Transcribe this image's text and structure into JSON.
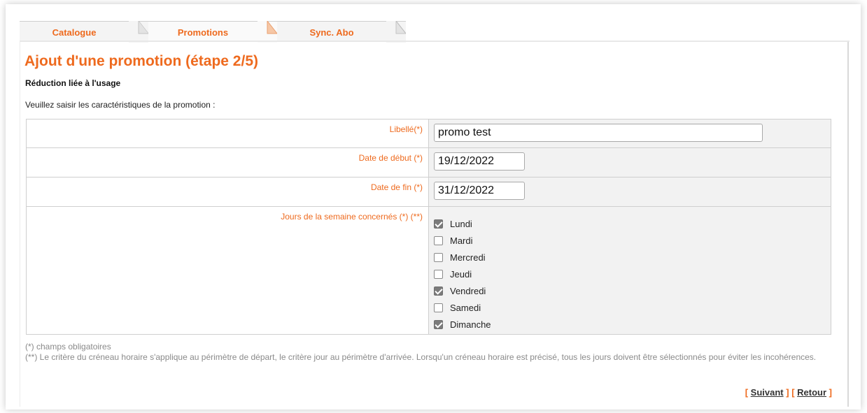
{
  "tabs": [
    {
      "label": "Catalogue"
    },
    {
      "label": "Promotions"
    },
    {
      "label": "Sync. Abo"
    }
  ],
  "page": {
    "title": "Ajout d'une promotion (étape 2/5)",
    "subtitle": "Réduction liée à l'usage",
    "intro": "Veuillez saisir les caractéristiques de la promotion :"
  },
  "form": {
    "libelle": {
      "label": "Libellé(*)",
      "value": "promo test"
    },
    "date_debut": {
      "label": "Date de début (*)",
      "value": "19/12/2022"
    },
    "date_fin": {
      "label": "Date de fin (*)",
      "value": "31/12/2022"
    },
    "jours": {
      "label": "Jours de la semaine concernés (*) (**)",
      "days": [
        {
          "label": "Lundi",
          "checked": true
        },
        {
          "label": "Mardi",
          "checked": false
        },
        {
          "label": "Mercredi",
          "checked": false
        },
        {
          "label": "Jeudi",
          "checked": false
        },
        {
          "label": "Vendredi",
          "checked": true
        },
        {
          "label": "Samedi",
          "checked": false
        },
        {
          "label": "Dimanche",
          "checked": true
        }
      ]
    }
  },
  "notes": {
    "required": "(*) champs obligatoires",
    "criteria": "(**) Le critère du créneau horaire s'applique au périmètre de départ, le critère jour au périmètre d'arrivée. Lorsqu'un créneau horaire est précisé, tous les jours doivent être sélectionnés pour éviter les incohérences."
  },
  "actions": {
    "next_label": "Suivant",
    "back_label": "Retour"
  },
  "colors": {
    "accent": "#ee6a1e"
  }
}
